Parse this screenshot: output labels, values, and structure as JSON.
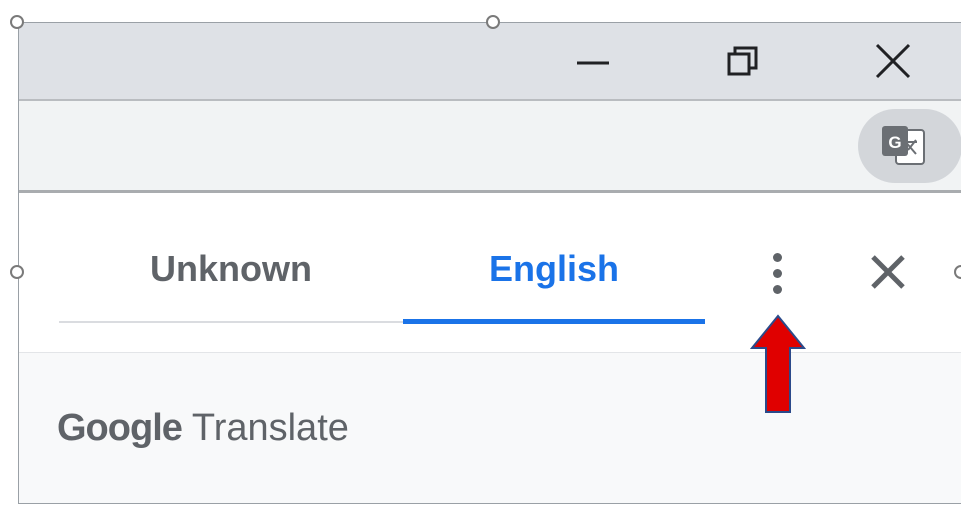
{
  "window_controls": {
    "minimize_icon": "minimize-icon",
    "restore_icon": "restore-icon",
    "close_icon": "close-icon"
  },
  "toolbar": {
    "translate_icon": "google-translate-icon"
  },
  "translate_bubble": {
    "tabs": [
      {
        "label": "Unknown",
        "selected": false
      },
      {
        "label": "English",
        "selected": true
      }
    ],
    "more_options_icon": "more-vert-icon",
    "close_icon": "close-icon",
    "footer": {
      "brand_google": "Google",
      "brand_product": "Translate"
    }
  },
  "annotation": {
    "arrow_color": "#e00000",
    "arrow_icon": "arrow-up-icon"
  },
  "colors": {
    "accent": "#1a73e8",
    "text_gray": "#5f6368",
    "titlebar": "#dee1e6",
    "toolbar": "#f1f3f4"
  }
}
